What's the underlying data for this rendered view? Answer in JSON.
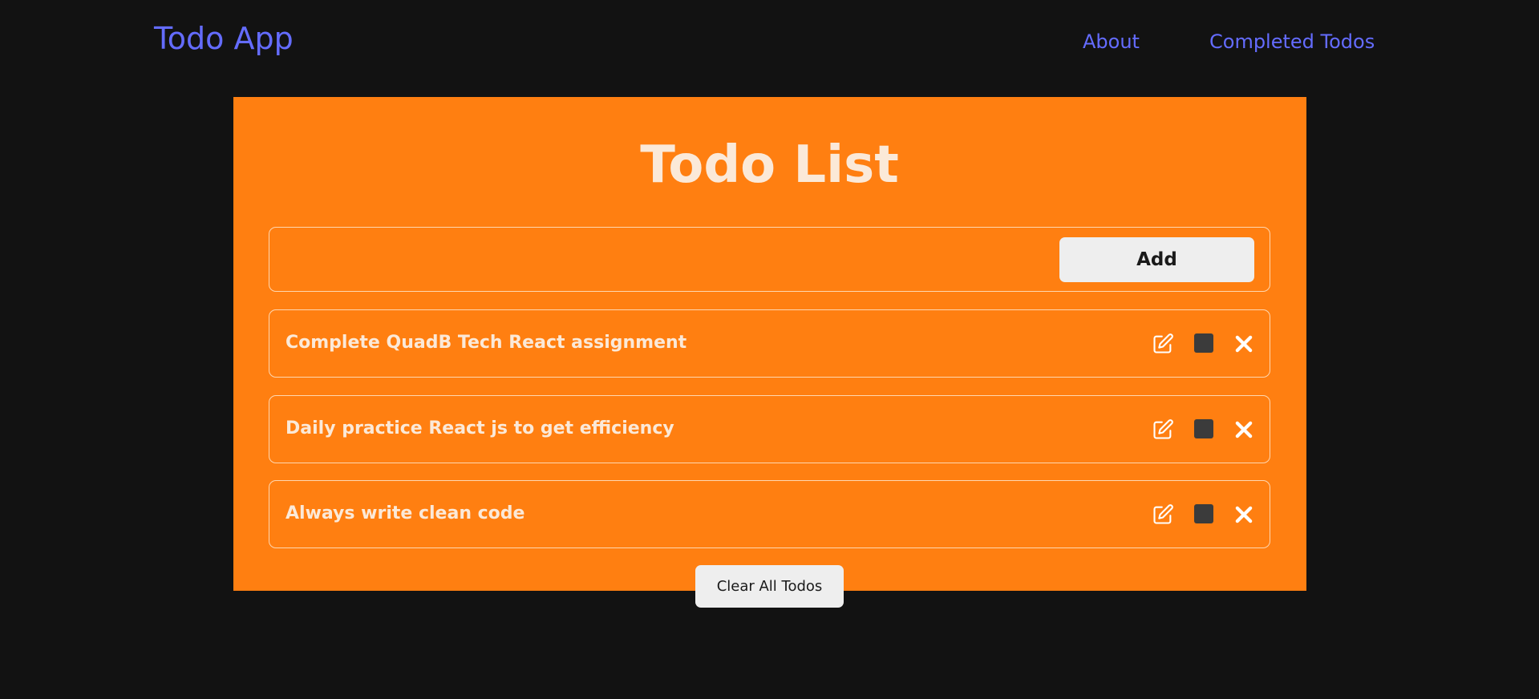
{
  "navbar": {
    "brand": "Todo App",
    "links": [
      "About",
      "Completed Todos"
    ]
  },
  "main": {
    "title": "Todo List",
    "input": {
      "value": "",
      "placeholder": ""
    },
    "add_label": "Add",
    "todos": [
      {
        "text": "Complete QuadB Tech React assignment",
        "completed": false
      },
      {
        "text": "Daily practice React js to get efficiency",
        "completed": false
      },
      {
        "text": "Always write clean code",
        "completed": false
      }
    ],
    "clear_label": "Clear All Todos"
  },
  "icons": {
    "edit": "edit-icon",
    "checkbox": "checkbox",
    "delete": "close-icon"
  },
  "colors": {
    "background": "#121212",
    "accent": "#646cff",
    "card": "#ff7f11",
    "text_light": "#fbe9d8",
    "button_bg": "#eeeeee"
  }
}
